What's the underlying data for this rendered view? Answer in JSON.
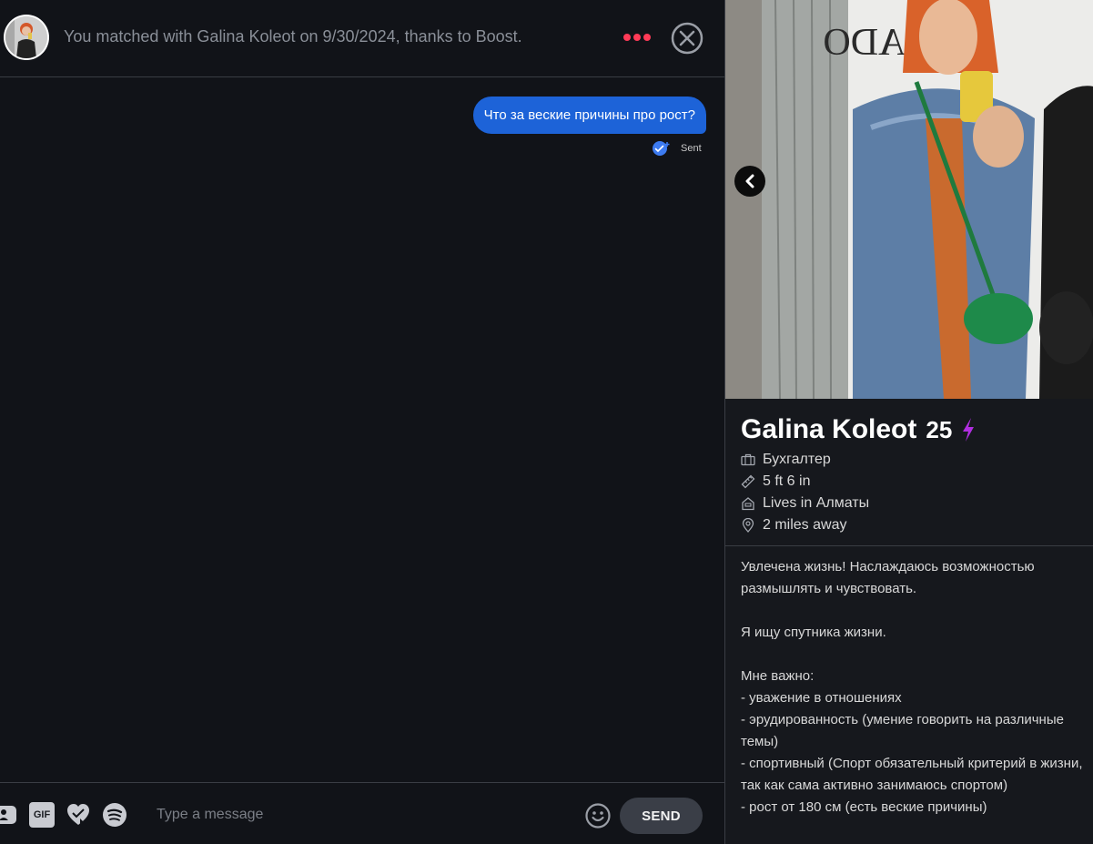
{
  "chat": {
    "match_text": "You matched with Galina Koleot on 9/30/2024, thanks to Boost.",
    "messages": [
      {
        "text": "Что за веские причины про рост?",
        "status": "Sent"
      }
    ],
    "composer": {
      "placeholder": "Type a message",
      "gif_label": "GIF",
      "send_label": "SEND"
    },
    "accent_color": "#1d63d8",
    "dots_color": "#ff3b57"
  },
  "profile": {
    "name": "Galina Koleot",
    "age": "25",
    "boost_color": "#b02ee0",
    "facts": [
      {
        "icon": "briefcase-icon",
        "text": "Бухгалтер"
      },
      {
        "icon": "ruler-icon",
        "text": "5 ft 6 in"
      },
      {
        "icon": "home-icon",
        "text": "Lives in Алматы"
      },
      {
        "icon": "location-pin-icon",
        "text": "2 miles away"
      }
    ],
    "bio": "Увлечена жизнь! Наслаждаюсь возможностью размышлять и чувствовать.\n\nЯ ищу спутника жизни.\n\nМне важно:\n- уважение в отношениях\n- эрудированность (умение говорить на различные темы)\n- спортивный (Спорт обязательный критерий в жизни, так как сама активно занимаюсь спортом)\n- рост от 180 см (есть веские причины)"
  }
}
